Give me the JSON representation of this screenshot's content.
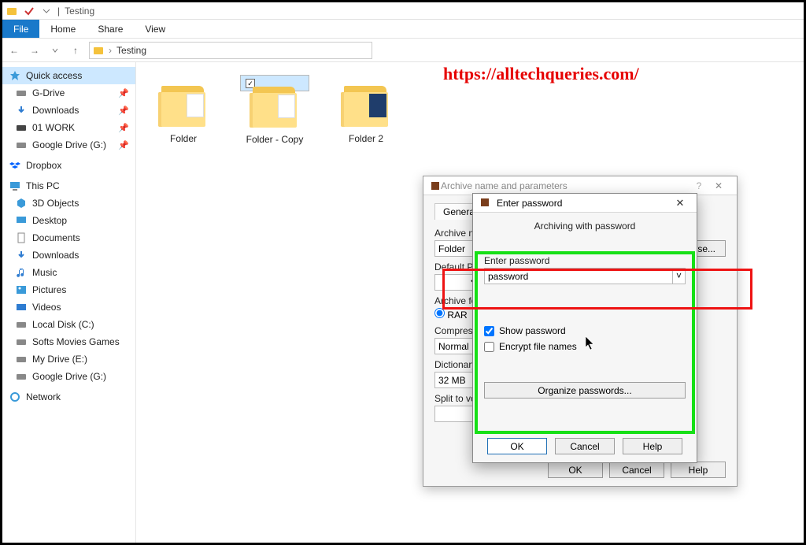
{
  "titlebar": {
    "title": "Testing"
  },
  "ribbon": {
    "file": "File",
    "home": "Home",
    "share": "Share",
    "view": "View"
  },
  "breadcrumb": {
    "root": "",
    "sep": "›",
    "current": "Testing"
  },
  "watermark": "https://alltechqueries.com/",
  "sidebar": {
    "quick": "Quick access",
    "items": [
      "G-Drive",
      "Downloads",
      "01 WORK",
      "Google Drive (G:)"
    ],
    "dropbox": "Dropbox",
    "thispc": "This PC",
    "pcitems": [
      "3D Objects",
      "Desktop",
      "Documents",
      "Downloads",
      "Music",
      "Pictures",
      "Videos",
      "Local Disk (C:)",
      "Softs Movies Games",
      "My Drive (E:)",
      "Google Drive (G:)"
    ],
    "network": "Network"
  },
  "folders": [
    {
      "name": "Folder"
    },
    {
      "name": "Folder - Copy"
    },
    {
      "name": "Folder 2"
    }
  ],
  "dialogA": {
    "title": "Archive name and parameters",
    "tab_general": "General",
    "archive_name_label": "Archive name",
    "archive_name_value": "Folder",
    "browse": "Browse...",
    "default_profile_label": "Default Profile",
    "archive_format_label": "Archive format",
    "rar": "RAR",
    "comp_label": "Compression method",
    "comp_value": "Normal",
    "dict_label": "Dictionary size",
    "dict_value": "32 MB",
    "split_label": "Split to volumes, size",
    "ok": "OK",
    "cancel": "Cancel",
    "help": "Help"
  },
  "dialogB": {
    "title": "Enter password",
    "subtitle": "Archiving with password",
    "enter_password": "Enter password",
    "value": "password",
    "show_password": "Show password",
    "encrypt_filenames": "Encrypt file names",
    "organize": "Organize passwords...",
    "ok": "OK",
    "cancel": "Cancel",
    "help": "Help"
  }
}
